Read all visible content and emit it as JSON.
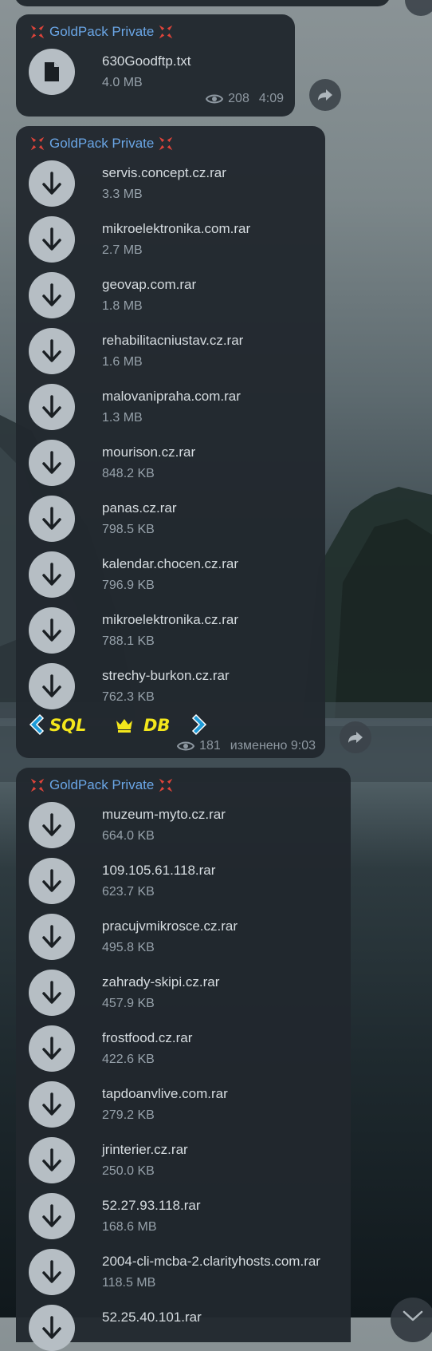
{
  "channel_name": "GoldPack Private",
  "icons": {
    "header_emoji": "anger-symbol-icon",
    "file_doc": "document-icon",
    "file_download": "download-arrow-icon",
    "views": "eye-icon",
    "share": "share-arrow-icon",
    "scroll": "chevron-down-icon"
  },
  "colors": {
    "bubble": "#21282e",
    "channel_name": "#6aa6e6",
    "emoji": "#e0443a",
    "file_circle": "#b6bec4",
    "logo_yellow": "#f3e61c",
    "logo_blue": "#1e9bd8"
  },
  "message1": {
    "file": {
      "name": "630Goodftp.txt",
      "size": "4.0 MB"
    },
    "views": "208",
    "time": "4:09"
  },
  "message2": {
    "files": [
      {
        "name": "servis.concept.cz.rar",
        "size": "3.3 MB"
      },
      {
        "name": "mikroelektronika.com.rar",
        "size": "2.7 MB"
      },
      {
        "name": "geovap.com.rar",
        "size": "1.8 MB"
      },
      {
        "name": "rehabilitacniustav.cz.rar",
        "size": "1.6 MB"
      },
      {
        "name": "malovanipraha.com.rar",
        "size": "1.3 MB"
      },
      {
        "name": "mourison.cz.rar",
        "size": "848.2 KB"
      },
      {
        "name": "panas.cz.rar",
        "size": "798.5 KB"
      },
      {
        "name": "kalendar.chocen.cz.rar",
        "size": "796.9 KB"
      },
      {
        "name": "mikroelektronika.cz.rar",
        "size": "788.1 KB"
      },
      {
        "name": "strechy-burkon.cz.rar",
        "size": "762.3 KB"
      }
    ],
    "logo_text": "SQL",
    "logo_text2": "DB",
    "views": "181",
    "time": "изменено 9:03"
  },
  "message3": {
    "files": [
      {
        "name": "muzeum-myto.cz.rar",
        "size": "664.0 KB"
      },
      {
        "name": "109.105.61.118.rar",
        "size": "623.7 KB"
      },
      {
        "name": "pracujvmikrosce.cz.rar",
        "size": "495.8 KB"
      },
      {
        "name": "zahrady-skipi.cz.rar",
        "size": "457.9 KB"
      },
      {
        "name": "frostfood.cz.rar",
        "size": "422.6 KB"
      },
      {
        "name": "tapdoanvlive.com.rar",
        "size": "279.2 KB"
      },
      {
        "name": "jrinterier.cz.rar",
        "size": "250.0 KB"
      },
      {
        "name": "52.27.93.118.rar",
        "size": "168.6 MB"
      },
      {
        "name": "2004-cli-mcba-2.clarityhosts.com.rar",
        "size": "118.5 MB"
      },
      {
        "name": "52.25.40.101.rar",
        "size": ""
      }
    ]
  }
}
